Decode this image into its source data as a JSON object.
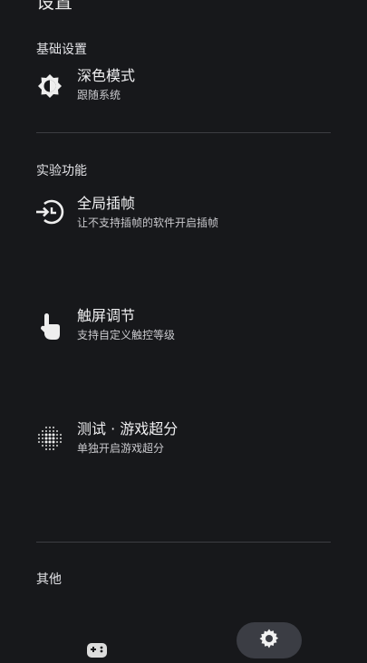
{
  "header": {
    "title": "设置"
  },
  "sections": {
    "basic": {
      "label": "基础设置",
      "dark_mode": {
        "title": "深色模式",
        "subtitle": "跟随系统",
        "icon": "brightness-auto-icon"
      }
    },
    "experimental": {
      "label": "实验功能",
      "frame_interp": {
        "title": "全局插帧",
        "subtitle": "让不支持插帧的软件开启插帧",
        "icon": "frame-interpolation-icon"
      },
      "touch": {
        "title": "触屏调节",
        "subtitle": "支持自定义触控等级",
        "icon": "touch-hand-icon"
      },
      "upscale": {
        "title": "测试 · 游戏超分",
        "subtitle": "单独开启游戏超分",
        "icon": "dot-grid-icon"
      }
    },
    "other": {
      "label": "其他"
    }
  },
  "bottom_nav": {
    "items": [
      {
        "name": "games",
        "icon": "gamepad-icon",
        "selected": false
      },
      {
        "name": "settings",
        "icon": "gear-icon",
        "selected": true
      }
    ]
  },
  "colors": {
    "background": "#17181b",
    "divider": "#3c3d42",
    "nav_pill": "#3b3d44"
  }
}
